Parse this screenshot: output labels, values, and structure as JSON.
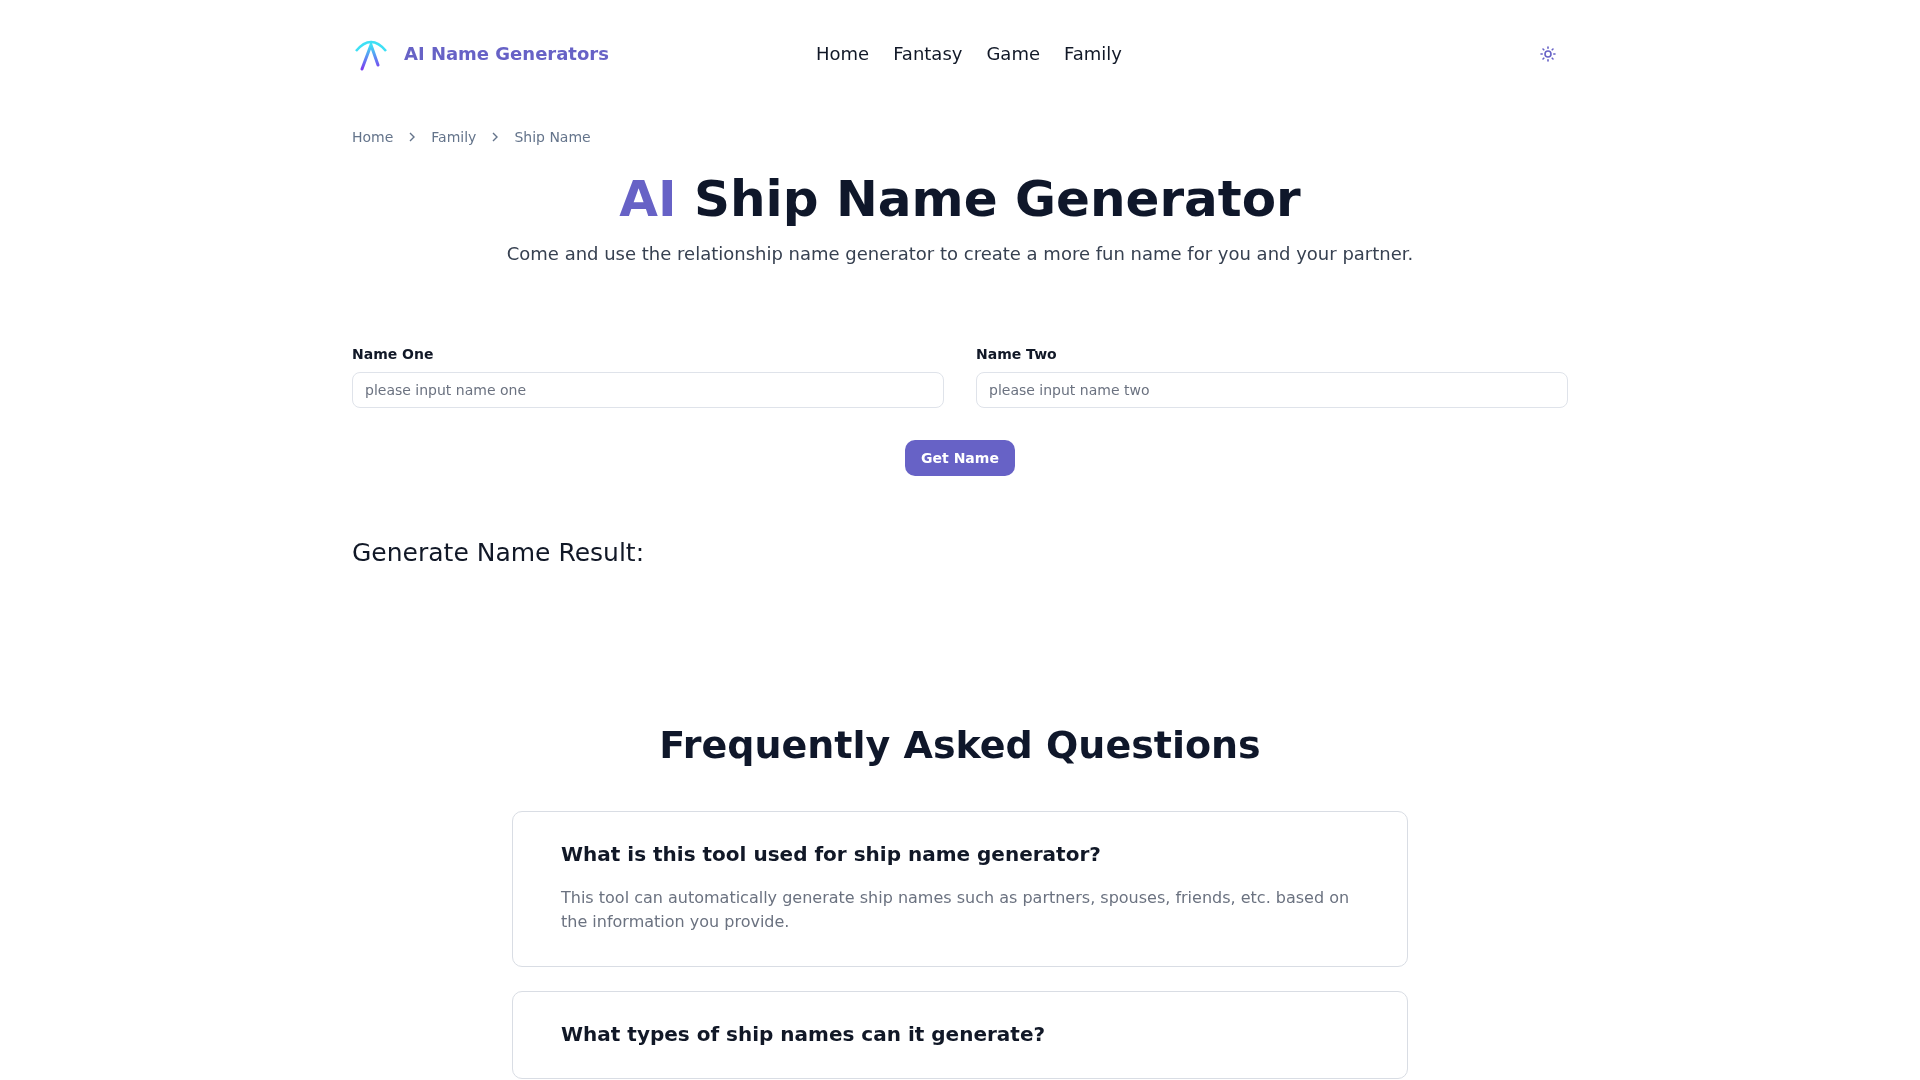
{
  "header": {
    "brand": "AI Name Generators",
    "nav": [
      {
        "label": "Home"
      },
      {
        "label": "Fantasy"
      },
      {
        "label": "Game"
      },
      {
        "label": "Family"
      }
    ]
  },
  "breadcrumb": [
    "Home",
    "Family",
    "Ship Name"
  ],
  "hero": {
    "title_accent": "AI",
    "title": "Ship Name Generator",
    "subtitle": "Come and use the relationship name generator to create a more fun name for you and your partner."
  },
  "form": {
    "fields": [
      {
        "label": "Name One",
        "placeholder": "please input name one"
      },
      {
        "label": "Name Two",
        "placeholder": "please input name two"
      }
    ],
    "button": "Get Name"
  },
  "result": {
    "heading": "Generate Name Result:"
  },
  "faq": {
    "title": "Frequently Asked Questions",
    "items": [
      {
        "question": "What is this tool used for ship name generator?",
        "answer": "This tool can automatically generate ship names such as partners, spouses, friends, etc. based on the information you provide."
      },
      {
        "question": "What types of ship names can it generate?"
      }
    ]
  }
}
